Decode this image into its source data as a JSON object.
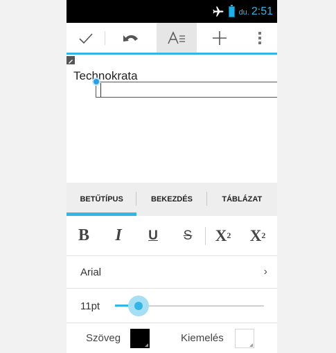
{
  "status_bar": {
    "time_prefix": "du.",
    "time": "2:51"
  },
  "action_bar": {
    "buttons": [
      "done-check",
      "undo",
      "text-format",
      "add",
      "overflow-menu"
    ]
  },
  "document": {
    "text": "Technokrata"
  },
  "tabs": [
    {
      "label": "BETŰTÍPUS",
      "active": true
    },
    {
      "label": "BEKEZDÉS",
      "active": false
    },
    {
      "label": "TÁBLÁZAT",
      "active": false
    }
  ],
  "format": {
    "bold": "B",
    "italic": "I",
    "underline": "U",
    "strikethrough": "S",
    "superscript_base": "X",
    "superscript_exp": "2",
    "subscript_base": "X",
    "subscript_exp": "2"
  },
  "font": {
    "name": "Arial",
    "chevron": "›"
  },
  "size": {
    "label": "11pt",
    "slider_fraction": 0.16
  },
  "colors": {
    "text_label": "Szöveg",
    "text_color": "#000000",
    "highlight_label": "Kiemelés",
    "highlight_color": "#ffffff",
    "accent": "#33b5e5"
  }
}
